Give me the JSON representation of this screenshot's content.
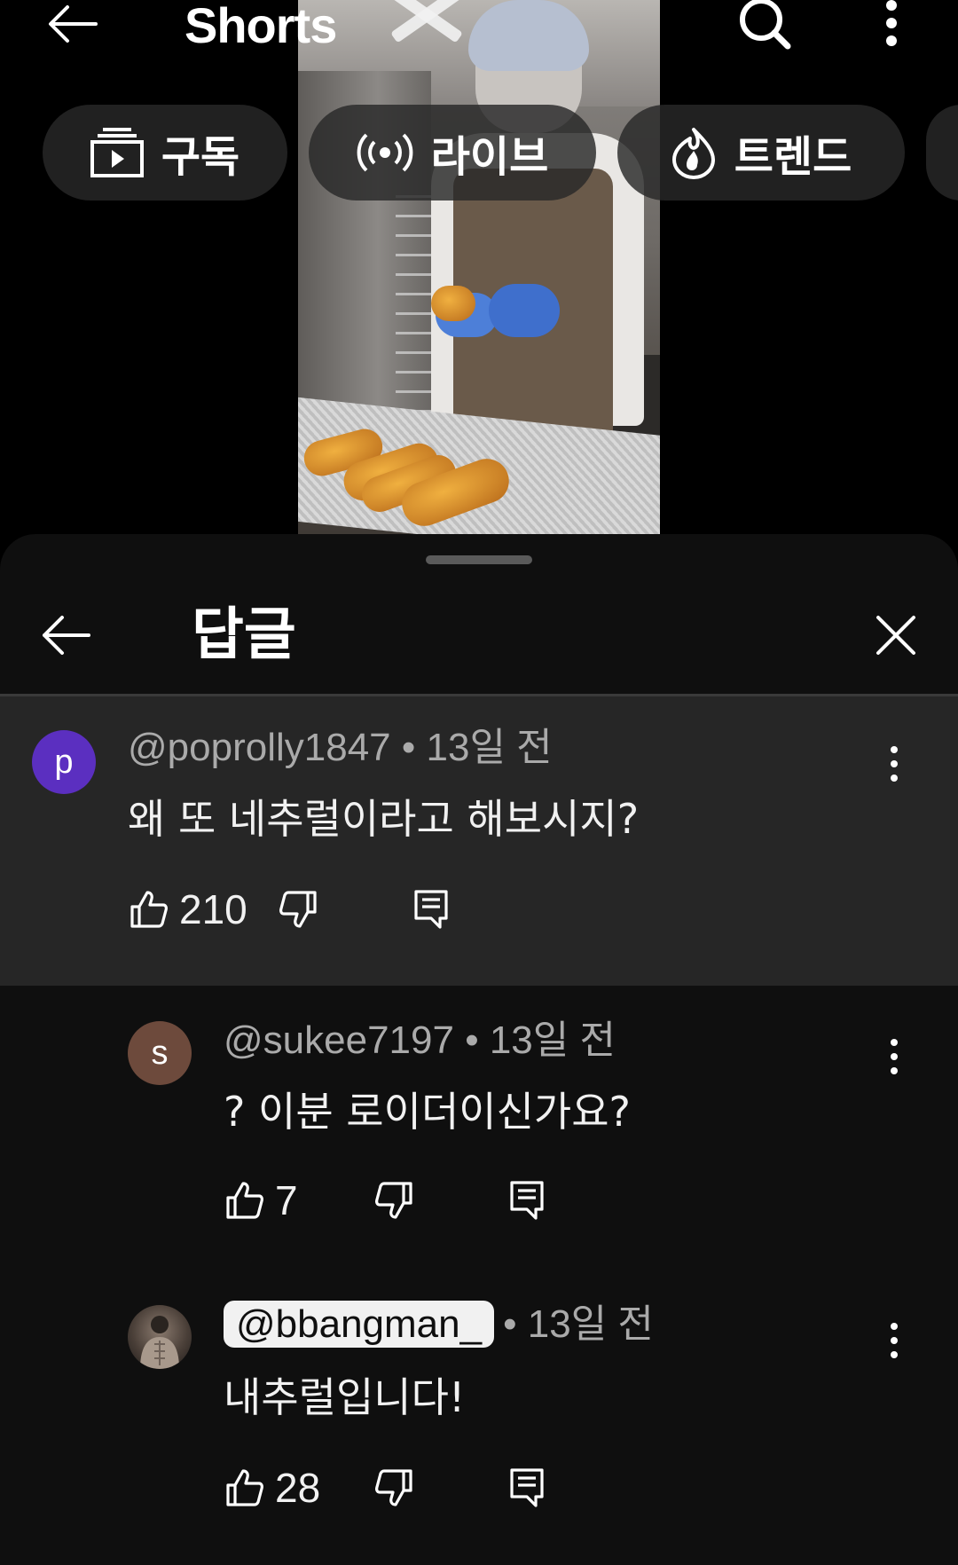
{
  "header": {
    "title": "Shorts"
  },
  "chips": [
    {
      "label": "구독",
      "icon": "subscriptions-icon"
    },
    {
      "label": "라이브",
      "icon": "live-icon"
    },
    {
      "label": "트렌드",
      "icon": "trending-icon"
    }
  ],
  "sheet": {
    "title": "답글"
  },
  "comments": [
    {
      "avatar_letter": "p",
      "avatar_color": "#5b2fc0",
      "handle": "@poprolly1847",
      "time": "• 13일 전",
      "text": "왜 또 네추럴이라고 해보시지?",
      "likes": "210"
    },
    {
      "avatar_letter": "s",
      "avatar_color": "#6d4a3c",
      "handle": "@sukee7197",
      "time": "• 13일 전",
      "text": "? 이분 로이더이신가요?",
      "likes": "7"
    },
    {
      "avatar_letter": "",
      "avatar_color": "#3a3a3a",
      "handle": "@bbangman_",
      "time": "• 13일 전",
      "text": "내추럴입니다!",
      "likes": "28"
    }
  ]
}
